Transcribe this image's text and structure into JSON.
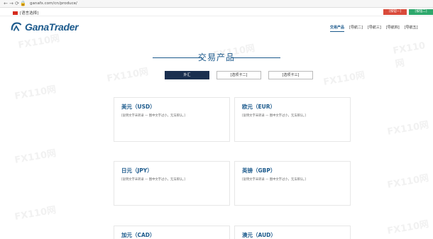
{
  "browser": {
    "url": "ganafx.com/cn/produce/"
  },
  "topbar": {
    "language": "[语言选择]",
    "btn_open_live": "[按钮一]",
    "btn_open_demo": "[按钮二]"
  },
  "logo": {
    "text": "GanaTrader"
  },
  "nav": {
    "items": [
      "交易产品",
      "[导航二]",
      "[导航三]",
      "[导航四]",
      "[导航五]"
    ]
  },
  "page": {
    "title": "交易产品"
  },
  "tabs": [
    "外汇",
    "[选项卡二]",
    "[选项卡三]"
  ],
  "cards": [
    {
      "title": "美元（USD）",
      "desc": "[说明文字未转录 — 图中文字过小，无法辨认。]"
    },
    {
      "title": "欧元（EUR）",
      "desc": "[说明文字未转录 — 图中文字过小，无法辨认。]"
    },
    {
      "title": "日元（JPY）",
      "desc": "[说明文字未转录 — 图中文字过小，无法辨认。]"
    },
    {
      "title": "英镑（GBP）",
      "desc": "[说明文字未转录 — 图中文字过小，无法辨认。]"
    },
    {
      "title": "加元（CAD）",
      "desc": ""
    },
    {
      "title": "澳元（AUD）",
      "desc": ""
    }
  ],
  "watermark": {
    "text": "FX110网"
  },
  "colors": {
    "brand": "#1c5a8c",
    "tab_active": "#1a2f4f",
    "btn_red": "#d94a3a",
    "btn_green": "#2ea86c"
  }
}
